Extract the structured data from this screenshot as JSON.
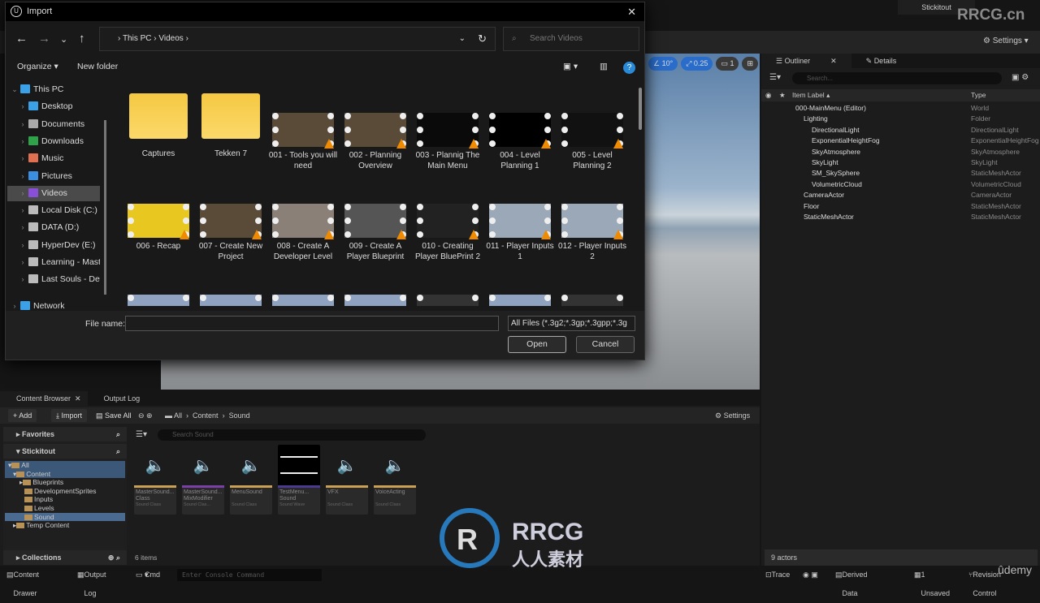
{
  "editor": {
    "project": "Stickitout",
    "watermark": "RRCG.cn",
    "settings": "Settings",
    "viewport_tools": [
      "10°",
      "0.25",
      "1"
    ]
  },
  "outliner": {
    "tabs": [
      "Outliner",
      "Details"
    ],
    "search_placeholder": "Search...",
    "col_label": "Item Label",
    "col_type": "Type",
    "rows": [
      {
        "label": "000-MainMenu (Editor)",
        "type": "World",
        "indent": 0
      },
      {
        "label": "Lighting",
        "type": "Folder",
        "indent": 1
      },
      {
        "label": "DirectionalLight",
        "type": "DirectionalLight",
        "indent": 2
      },
      {
        "label": "ExponentialHeightFog",
        "type": "ExponentialHeightFog",
        "indent": 2
      },
      {
        "label": "SkyAtmosphere",
        "type": "SkyAtmosphere",
        "indent": 2
      },
      {
        "label": "SkyLight",
        "type": "SkyLight",
        "indent": 2
      },
      {
        "label": "SM_SkySphere",
        "type": "StaticMeshActor",
        "indent": 2
      },
      {
        "label": "VolumetricCloud",
        "type": "VolumetricCloud",
        "indent": 2
      },
      {
        "label": "CameraActor",
        "type": "CameraActor",
        "indent": 1
      },
      {
        "label": "Floor",
        "type": "StaticMeshActor",
        "indent": 1
      },
      {
        "label": "StaticMeshActor",
        "type": "StaticMeshActor",
        "indent": 1
      }
    ],
    "footer": "9 actors"
  },
  "content_browser": {
    "tabs": [
      "Content Browser",
      "Output Log"
    ],
    "add": "Add",
    "import": "Import",
    "save_all": "Save All",
    "breadcrumb": [
      "All",
      "Content",
      "Sound"
    ],
    "settings": "Settings",
    "favorites": "Favorites",
    "project": "Stickitout",
    "collections": "Collections",
    "tree": [
      "All",
      "Content",
      "Blueprints",
      "DevelopmentSprites",
      "Inputs",
      "Levels",
      "Sound",
      "Temp Content"
    ],
    "search_placeholder": "Search Sound",
    "count": "6 items",
    "assets": [
      {
        "name": "MasterSound... Class",
        "type": "Sound Class",
        "color": "#c9a054"
      },
      {
        "name": "MasterSound... MixModifier",
        "type": "Sound Clas...",
        "color": "#7b3fa8"
      },
      {
        "name": "MenuSound",
        "type": "Sound Class",
        "color": "#c9a054"
      },
      {
        "name": "TestMenu... Sound",
        "type": "Sound Wave",
        "color": "#4b3a90"
      },
      {
        "name": "VFX",
        "type": "Sound Class",
        "color": "#c9a054"
      },
      {
        "name": "VoiceActing",
        "type": "Sound Class",
        "color": "#c9a054"
      }
    ]
  },
  "status_bar": {
    "content_drawer": "Content Drawer",
    "output_log": "Output Log",
    "cmd": "Cmd",
    "console_placeholder": "Enter Console Command",
    "trace": "Trace",
    "derived_data": "Derived Data",
    "unsaved": "1 Unsaved",
    "revision": "Revision Control",
    "udemy": "ûdemy"
  },
  "dialog": {
    "title": "Import",
    "path": [
      "This PC",
      "Videos"
    ],
    "search_placeholder": "Search Videos",
    "organize": "Organize ▾",
    "new_folder": "New folder",
    "nav": [
      {
        "label": "This PC",
        "color": "#3aa0e8",
        "level": 0
      },
      {
        "label": "Desktop",
        "color": "#3aa0e8",
        "level": 1
      },
      {
        "label": "Documents",
        "color": "#aaaaaa",
        "level": 1
      },
      {
        "label": "Downloads",
        "color": "#2ea34a",
        "level": 1
      },
      {
        "label": "Music",
        "color": "#e07050",
        "level": 1
      },
      {
        "label": "Pictures",
        "color": "#3a8fe0",
        "level": 1
      },
      {
        "label": "Videos",
        "color": "#8a4fd8",
        "level": 1,
        "selected": true
      },
      {
        "label": "Local Disk (C:)",
        "color": "#bbbbbb",
        "level": 1
      },
      {
        "label": "DATA (D:)",
        "color": "#bbbbbb",
        "level": 1
      },
      {
        "label": "HyperDev (E:)",
        "color": "#bbbbbb",
        "level": 1
      },
      {
        "label": "Learning - Maste",
        "color": "#bbbbbb",
        "level": 1
      },
      {
        "label": "Last Souls - Deve",
        "color": "#bbbbbb",
        "level": 1
      },
      {
        "label": "Network",
        "color": "#3aa0e8",
        "level": 0
      }
    ],
    "files": [
      {
        "name": "Captures",
        "kind": "folder"
      },
      {
        "name": "Tekken 7",
        "kind": "folder"
      },
      {
        "name": "001 - Tools you will need",
        "kind": "video",
        "thumb": "#5a4a38"
      },
      {
        "name": "002 - Planning Overview",
        "kind": "video",
        "thumb": "#5a4a38"
      },
      {
        "name": "003 - Plannig The Main Menu",
        "kind": "video",
        "thumb": "#0a0a0a"
      },
      {
        "name": "004 - Level Planning 1",
        "kind": "video",
        "thumb": "#000000"
      },
      {
        "name": "005 - Level Planning 2",
        "kind": "video",
        "thumb": "#111111"
      },
      {
        "name": "006 - Recap",
        "kind": "video",
        "thumb": "#e8c820"
      },
      {
        "name": "007 - Create New Project",
        "kind": "video",
        "thumb": "#5a4a38"
      },
      {
        "name": "008 - Create A Developer Level",
        "kind": "video",
        "thumb": "#8a8078"
      },
      {
        "name": "009 - Create A Player Blueprint",
        "kind": "video",
        "thumb": "#555555"
      },
      {
        "name": "010 - Creating Player BluePrint 2",
        "kind": "video",
        "thumb": "#222222"
      },
      {
        "name": "011 - Player Inputs 1",
        "kind": "video",
        "thumb": "#9aa8b8"
      },
      {
        "name": "012 - Player Inputs 2",
        "kind": "video",
        "thumb": "#9aa8b8"
      },
      {
        "name": "",
        "kind": "video",
        "thumb": "#8fa3c0"
      },
      {
        "name": "",
        "kind": "video",
        "thumb": "#8fa3c0"
      },
      {
        "name": "",
        "kind": "video",
        "thumb": "#8fa3c0"
      },
      {
        "name": "",
        "kind": "video",
        "thumb": "#8fa3c0"
      },
      {
        "name": "",
        "kind": "video",
        "thumb": "#333333"
      },
      {
        "name": "",
        "kind": "video",
        "thumb": "#8fa3c0"
      },
      {
        "name": "",
        "kind": "video",
        "thumb": "#333333"
      }
    ],
    "file_name_label": "File name:",
    "file_name_value": "",
    "file_type": "All Files (*.3g2;*.3gp;*.3gpp;*.3g",
    "open": "Open",
    "cancel": "Cancel"
  },
  "logo_text": "RRCG 人人素材"
}
